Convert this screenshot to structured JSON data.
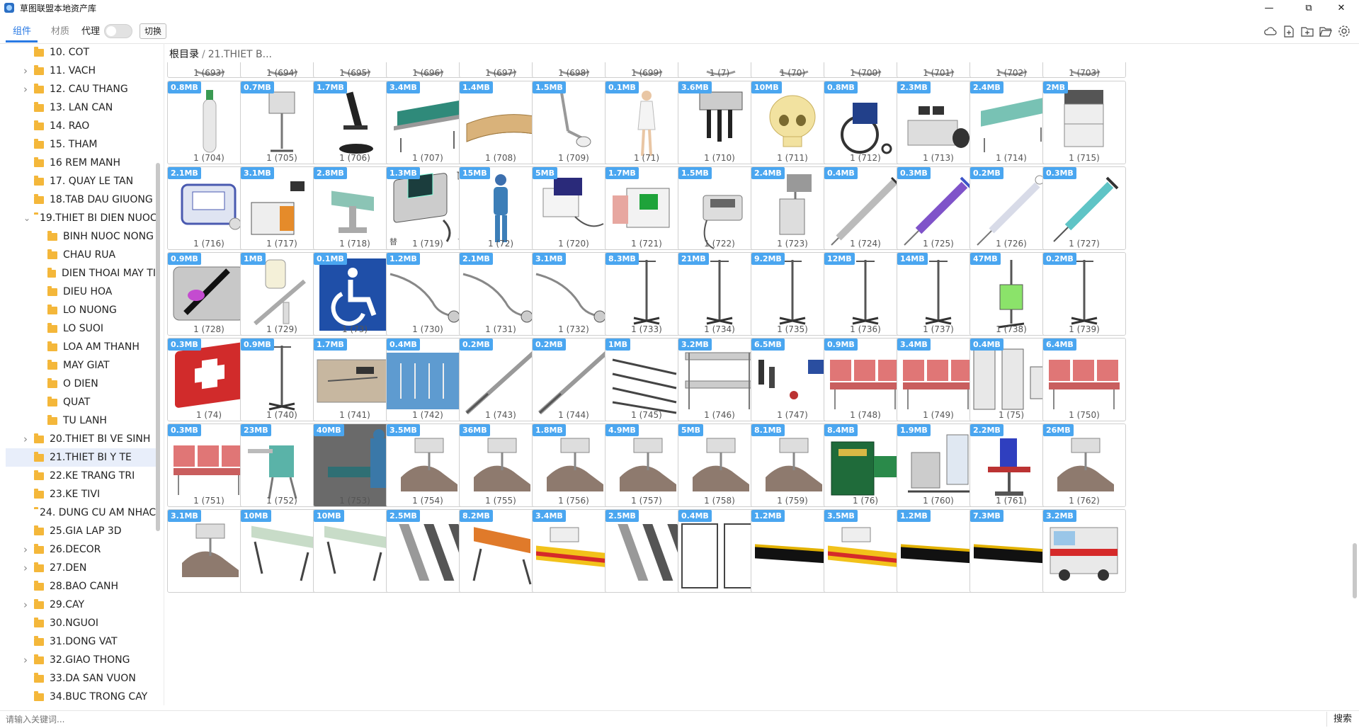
{
  "window": {
    "title": "草图联盟本地资产库",
    "controls": [
      "minimize",
      "maximize",
      "close"
    ]
  },
  "toolbar": {
    "tabs": [
      {
        "label": "组件",
        "active": true
      },
      {
        "label": "材质",
        "active": false
      }
    ],
    "proxy_label": "代理",
    "proxy_enabled": false,
    "switch_label": "切换",
    "icons": [
      "cloud-icon",
      "new-file-icon",
      "new-folder-icon",
      "open-folder-icon",
      "settings-icon"
    ]
  },
  "breadcrumb": {
    "root": "根目录",
    "separator": "/",
    "current": "21.THIET B..."
  },
  "tree": [
    {
      "label": "10. COT",
      "level": 0,
      "has_children": false
    },
    {
      "label": "11. VACH",
      "level": 0,
      "has_children": true
    },
    {
      "label": "12. CAU THANG",
      "level": 0,
      "has_children": true
    },
    {
      "label": "13. LAN CAN",
      "level": 0,
      "has_children": false
    },
    {
      "label": "14. RAO",
      "level": 0,
      "has_children": false
    },
    {
      "label": "15. THAM",
      "level": 0,
      "has_children": false
    },
    {
      "label": "16 REM MANH",
      "level": 0,
      "has_children": false
    },
    {
      "label": "17. QUAY LE TAN",
      "level": 0,
      "has_children": false
    },
    {
      "label": "18.TAB DAU GIUONG",
      "level": 0,
      "has_children": false
    },
    {
      "label": "19.THIET BI DIEN NUOC",
      "level": 0,
      "has_children": true,
      "expanded": true
    },
    {
      "label": "BINH NUOC NONG",
      "level": 1,
      "has_children": false
    },
    {
      "label": "CHAU RUA",
      "level": 1,
      "has_children": false
    },
    {
      "label": "DIEN THOAI MAY TI",
      "level": 1,
      "has_children": false
    },
    {
      "label": "DIEU HOA",
      "level": 1,
      "has_children": false
    },
    {
      "label": "LO NUONG",
      "level": 1,
      "has_children": false
    },
    {
      "label": "LO SUOI",
      "level": 1,
      "has_children": false
    },
    {
      "label": "LOA AM THANH",
      "level": 1,
      "has_children": false
    },
    {
      "label": "MAY GIAT",
      "level": 1,
      "has_children": false
    },
    {
      "label": "O DIEN",
      "level": 1,
      "has_children": false
    },
    {
      "label": "QUAT",
      "level": 1,
      "has_children": false
    },
    {
      "label": "TU LANH",
      "level": 1,
      "has_children": false
    },
    {
      "label": "20.THIET BI VE SINH",
      "level": 0,
      "has_children": true
    },
    {
      "label": "21.THIET BI Y TE",
      "level": 0,
      "has_children": false,
      "selected": true
    },
    {
      "label": "22.KE TRANG TRI",
      "level": 0,
      "has_children": false
    },
    {
      "label": "23.KE TIVI",
      "level": 0,
      "has_children": false
    },
    {
      "label": "24. DUNG CU AM NHAC",
      "level": 0,
      "has_children": false
    },
    {
      "label": "25.GIA LAP 3D",
      "level": 0,
      "has_children": false
    },
    {
      "label": "26.DECOR",
      "level": 0,
      "has_children": true
    },
    {
      "label": "27.DEN",
      "level": 0,
      "has_children": true
    },
    {
      "label": "28.BAO CANH",
      "level": 0,
      "has_children": false
    },
    {
      "label": "29.CAY",
      "level": 0,
      "has_children": true
    },
    {
      "label": "30.NGUOI",
      "level": 0,
      "has_children": false
    },
    {
      "label": "31.DONG VAT",
      "level": 0,
      "has_children": false
    },
    {
      "label": "32.GIAO THONG",
      "level": 0,
      "has_children": true
    },
    {
      "label": "33.DA SAN VUON",
      "level": 0,
      "has_children": false
    },
    {
      "label": "34.BUC TRONG CAY",
      "level": 0,
      "has_children": false
    }
  ],
  "grid_rows": [
    [
      {
        "caption": "1 (693)",
        "size": ""
      },
      {
        "caption": "1 (694)",
        "size": ""
      },
      {
        "caption": "1 (695)",
        "size": ""
      },
      {
        "caption": "1 (696)",
        "size": ""
      },
      {
        "caption": "1 (697)",
        "size": ""
      },
      {
        "caption": "1 (698)",
        "size": ""
      },
      {
        "caption": "1 (699)",
        "size": ""
      },
      {
        "caption": "1 (7)",
        "size": ""
      },
      {
        "caption": "1 (70)",
        "size": ""
      },
      {
        "caption": "1 (700)",
        "size": ""
      },
      {
        "caption": "1 (701)",
        "size": ""
      },
      {
        "caption": "1 (702)",
        "size": ""
      },
      {
        "caption": "1 (703)",
        "size": ""
      }
    ],
    [
      {
        "caption": "1 (704)",
        "size": "0.8MB",
        "icon": "oxygen-tank-icon"
      },
      {
        "caption": "1 (705)",
        "size": "0.7MB",
        "icon": "monitor-stand-icon"
      },
      {
        "caption": "1 (706)",
        "size": "1.7MB",
        "icon": "microscope-icon"
      },
      {
        "caption": "1 (707)",
        "size": "3.4MB",
        "icon": "hospital-bed-icon"
      },
      {
        "caption": "1 (708)",
        "size": "1.4MB",
        "icon": "reception-desk-icon"
      },
      {
        "caption": "1 (709)",
        "size": "1.5MB",
        "icon": "exam-lamp-icon"
      },
      {
        "caption": "1 (71)",
        "size": "0.1MB",
        "icon": "nurse-icon"
      },
      {
        "caption": "1 (710)",
        "size": "3.6MB",
        "icon": "diagnostic-set-icon"
      },
      {
        "caption": "1 (711)",
        "size": "10MB",
        "icon": "skull-icon"
      },
      {
        "caption": "1 (712)",
        "size": "0.8MB",
        "icon": "wheelchair-icon"
      },
      {
        "caption": "1 (713)",
        "size": "2.3MB",
        "icon": "workstation-icon"
      },
      {
        "caption": "1 (714)",
        "size": "2.4MB",
        "icon": "stretcher-bed-icon"
      },
      {
        "caption": "1 (715)",
        "size": "2MB",
        "icon": "anesthesia-cart-icon"
      }
    ],
    [
      {
        "caption": "1 (716)",
        "size": "2.1MB",
        "icon": "portable-monitor-icon"
      },
      {
        "caption": "1 (717)",
        "size": "3.1MB",
        "icon": "ent-unit-icon"
      },
      {
        "caption": "1 (718)",
        "size": "2.8MB",
        "icon": "operating-table-icon"
      },
      {
        "caption": "1 (719)",
        "size": "1.3MB",
        "icon": "ecg-device-icon",
        "hover": true
      },
      {
        "caption": "1 (72)",
        "size": "15MB",
        "icon": "surgeon-icon"
      },
      {
        "caption": "1 (720)",
        "size": "5MB",
        "icon": "holter-icon"
      },
      {
        "caption": "1 (721)",
        "size": "1.7MB",
        "icon": "ultrasound-icon"
      },
      {
        "caption": "1 (722)",
        "size": "1.5MB",
        "icon": "dental-device-icon"
      },
      {
        "caption": "1 (723)",
        "size": "2.4MB",
        "icon": "xray-icon"
      },
      {
        "caption": "1 (724)",
        "size": "0.4MB",
        "icon": "syringe-icon"
      },
      {
        "caption": "1 (725)",
        "size": "0.3MB",
        "icon": "syringe-purple-icon"
      },
      {
        "caption": "1 (726)",
        "size": "0.2MB",
        "icon": "syringe-clear-icon"
      },
      {
        "caption": "1 (727)",
        "size": "0.3MB",
        "icon": "syringe-teal-icon"
      }
    ],
    [
      {
        "caption": "1 (728)",
        "size": "0.9MB",
        "icon": "injection-tray-icon"
      },
      {
        "caption": "1 (729)",
        "size": "1MB",
        "icon": "vial-set-icon"
      },
      {
        "caption": "1 (73)",
        "size": "0.1MB",
        "icon": "accessibility-sign-icon"
      },
      {
        "caption": "1 (730)",
        "size": "1.2MB",
        "icon": "stethoscope-icon"
      },
      {
        "caption": "1 (731)",
        "size": "2.1MB",
        "icon": "stethoscope-icon"
      },
      {
        "caption": "1 (732)",
        "size": "3.1MB",
        "icon": "stethoscope-icon"
      },
      {
        "caption": "1 (733)",
        "size": "8.3MB",
        "icon": "iv-stand-icon"
      },
      {
        "caption": "1 (734)",
        "size": "21MB",
        "icon": "iv-stand-icon"
      },
      {
        "caption": "1 (735)",
        "size": "9.2MB",
        "icon": "iv-stand-icon"
      },
      {
        "caption": "1 (736)",
        "size": "12MB",
        "icon": "iv-stand-icon"
      },
      {
        "caption": "1 (737)",
        "size": "14MB",
        "icon": "iv-stand-icon"
      },
      {
        "caption": "1 (738)",
        "size": "47MB",
        "icon": "iv-pump-icon"
      },
      {
        "caption": "1 (739)",
        "size": "0.2MB",
        "icon": "iv-stand-icon"
      }
    ],
    [
      {
        "caption": "1 (74)",
        "size": "0.3MB",
        "icon": "first-aid-kit-icon"
      },
      {
        "caption": "1 (740)",
        "size": "0.9MB",
        "icon": "iv-stand-icon"
      },
      {
        "caption": "1 (741)",
        "size": "1.7MB",
        "icon": "instrument-tray-icon"
      },
      {
        "caption": "1 (742)",
        "size": "0.4MB",
        "icon": "surgical-kit-icon"
      },
      {
        "caption": "1 (743)",
        "size": "0.2MB",
        "icon": "scalpel-icon"
      },
      {
        "caption": "1 (744)",
        "size": "0.2MB",
        "icon": "scalpel-icon"
      },
      {
        "caption": "1 (745)",
        "size": "1MB",
        "icon": "scalpel-set-icon"
      },
      {
        "caption": "1 (746)",
        "size": "3.2MB",
        "icon": "trolley-icon"
      },
      {
        "caption": "1 (747)",
        "size": "6.5MB",
        "icon": "tool-set-icon"
      },
      {
        "caption": "1 (748)",
        "size": "0.9MB",
        "icon": "waiting-chairs-icon"
      },
      {
        "caption": "1 (749)",
        "size": "3.4MB",
        "icon": "waiting-chairs-icon"
      },
      {
        "caption": "1 (75)",
        "size": "0.4MB",
        "icon": "panel-icon"
      },
      {
        "caption": "1 (750)",
        "size": "6.4MB",
        "icon": "waiting-chairs-icon"
      }
    ],
    [
      {
        "caption": "1 (751)",
        "size": "0.3MB",
        "icon": "waiting-chairs-icon"
      },
      {
        "caption": "1 (752)",
        "size": "23MB",
        "icon": "blood-chair-icon"
      },
      {
        "caption": "1 (753)",
        "size": "40MB",
        "icon": "surgery-scene-icon"
      },
      {
        "caption": "1 (754)",
        "size": "3.5MB",
        "icon": "dental-chair-icon"
      },
      {
        "caption": "1 (755)",
        "size": "36MB",
        "icon": "dental-chair-icon"
      },
      {
        "caption": "1 (756)",
        "size": "1.8MB",
        "icon": "dental-chair-icon"
      },
      {
        "caption": "1 (757)",
        "size": "4.9MB",
        "icon": "dental-chair-icon"
      },
      {
        "caption": "1 (758)",
        "size": "5MB",
        "icon": "dental-chair-icon"
      },
      {
        "caption": "1 (759)",
        "size": "8.1MB",
        "icon": "dental-chair-icon"
      },
      {
        "caption": "1 (76)",
        "size": "8.4MB",
        "icon": "medical-case-icon"
      },
      {
        "caption": "1 (760)",
        "size": "1.9MB",
        "icon": "dialysis-chair-icon"
      },
      {
        "caption": "1 (761)",
        "size": "2.2MB",
        "icon": "exam-chair-icon"
      },
      {
        "caption": "1 (762)",
        "size": "26MB",
        "icon": "dental-chair-icon"
      }
    ],
    [
      {
        "caption": "",
        "size": "3.1MB",
        "icon": "dental-chair-icon"
      },
      {
        "caption": "",
        "size": "10MB",
        "icon": "stretcher-icon"
      },
      {
        "caption": "",
        "size": "10MB",
        "icon": "stretcher-icon"
      },
      {
        "caption": "",
        "size": "2.5MB",
        "icon": "stretcher-frames-icon"
      },
      {
        "caption": "",
        "size": "8.2MB",
        "icon": "stretcher-orange-icon"
      },
      {
        "caption": "",
        "size": "3.4MB",
        "icon": "stretcher-yellow-icon"
      },
      {
        "caption": "",
        "size": "2.5MB",
        "icon": "stretcher-frames-icon"
      },
      {
        "caption": "",
        "size": "0.4MB",
        "icon": "door-frame-icon"
      },
      {
        "caption": "",
        "size": "1.2MB",
        "icon": "stretcher-black-icon"
      },
      {
        "caption": "",
        "size": "3.5MB",
        "icon": "stretcher-yellow-icon"
      },
      {
        "caption": "",
        "size": "1.2MB",
        "icon": "stretcher-black-icon"
      },
      {
        "caption": "",
        "size": "7.3MB",
        "icon": "stretcher-black-icon"
      },
      {
        "caption": "",
        "size": "3.2MB",
        "icon": "ambulance-icon"
      }
    ]
  ],
  "search": {
    "placeholder": "请输入关键词...",
    "button_label": "搜索"
  }
}
